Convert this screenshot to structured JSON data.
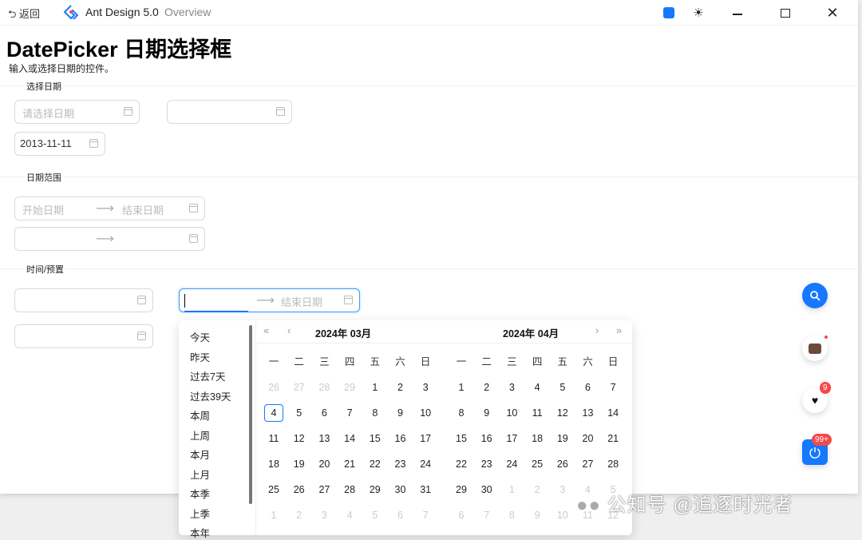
{
  "titlebar": {
    "back": "返回",
    "app": "Ant Design 5.0",
    "overview": "Overview"
  },
  "page": {
    "title": "DatePicker 日期选择框",
    "description": "输入或选择日期的控件。"
  },
  "sections": [
    {
      "label": "选择日期",
      "placeholder": "请选择日期",
      "value": "2013-11-11"
    },
    {
      "label": "日期范围",
      "start_placeholder": "开始日期",
      "end_placeholder": "结束日期"
    },
    {
      "label": "时间/预置",
      "end_placeholder": "结束日期"
    }
  ],
  "presets": [
    "今天",
    "昨天",
    "过去7天",
    "过去39天",
    "本周",
    "上周",
    "本月",
    "上月",
    "本季",
    "上季",
    "本年"
  ],
  "weekdays": [
    "一",
    "二",
    "三",
    "四",
    "五",
    "六",
    "日"
  ],
  "calendar": {
    "left": {
      "title": "2024年 03月",
      "days": [
        26,
        27,
        28,
        29,
        1,
        2,
        3,
        4,
        5,
        6,
        7,
        8,
        9,
        10,
        11,
        12,
        13,
        14,
        15,
        16,
        17,
        18,
        19,
        20,
        21,
        22,
        23,
        24,
        25,
        26,
        27,
        28,
        29,
        30,
        31,
        1,
        2,
        3,
        4,
        5,
        6,
        7
      ],
      "in_month_range": [
        4,
        34
      ],
      "today_index": 7
    },
    "right": {
      "title": "2024年 04月",
      "days": [
        1,
        2,
        3,
        4,
        5,
        6,
        7,
        8,
        9,
        10,
        11,
        12,
        13,
        14,
        15,
        16,
        17,
        18,
        19,
        20,
        21,
        22,
        23,
        24,
        25,
        26,
        27,
        28,
        29,
        30,
        1,
        2,
        3,
        4,
        5,
        6,
        7,
        8,
        9,
        10,
        11,
        12
      ],
      "in_month_range": [
        0,
        29
      ]
    }
  },
  "floats": {
    "heart_badge": "9",
    "power_badge": "99+"
  },
  "watermark": "公知号 @追逐时光者",
  "colors": {
    "primary": "#1677ff",
    "badge": "#f5484a"
  }
}
